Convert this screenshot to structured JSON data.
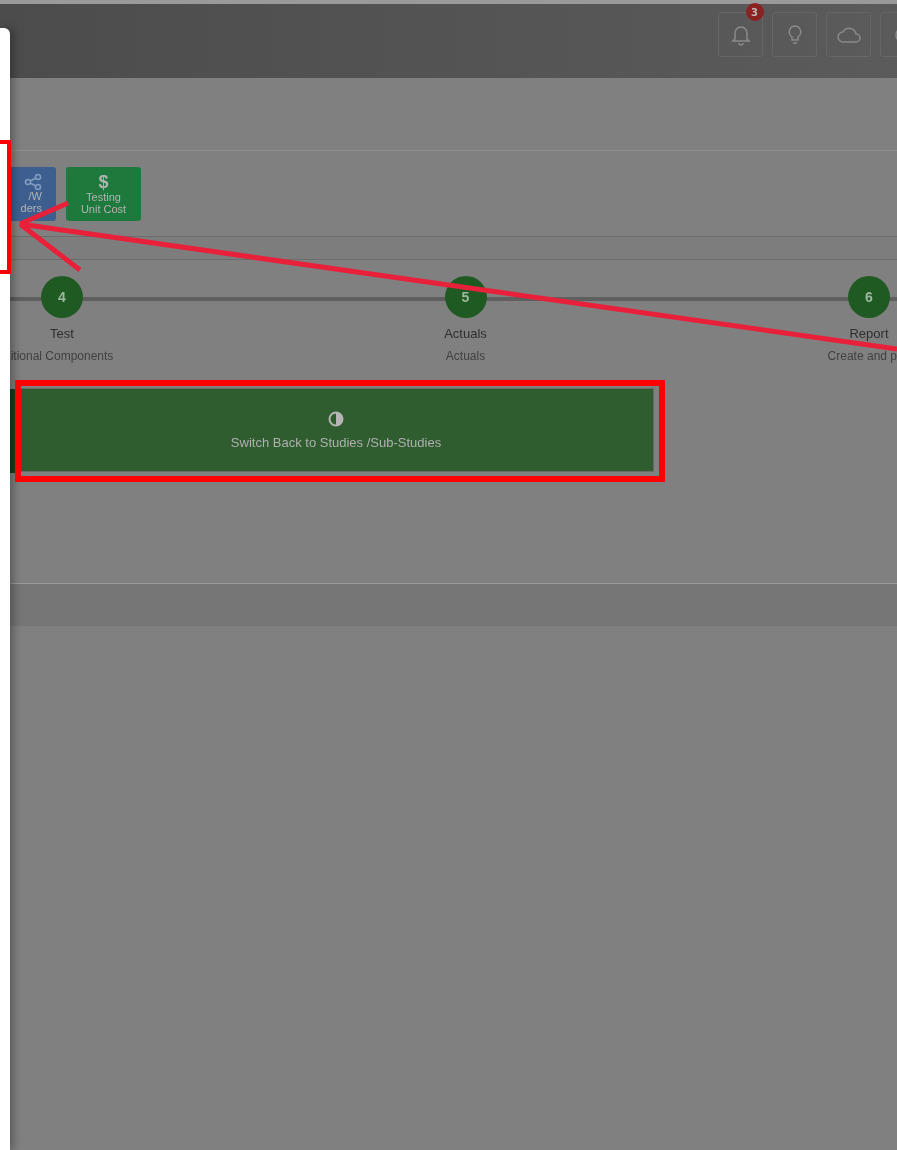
{
  "header": {
    "icons": [
      {
        "kind": "bell",
        "badge": "3"
      },
      {
        "kind": "bulb"
      },
      {
        "kind": "cloud"
      },
      {
        "kind": "partial"
      }
    ]
  },
  "tiles": [
    {
      "kind": "network",
      "color": "#3d5f8f",
      "lines": [
        "/W",
        "ders"
      ]
    },
    {
      "kind": "glyph",
      "glyph": "$",
      "color": "#1e7a3c",
      "lines": [
        "Testing",
        "Unit Cost"
      ]
    }
  ],
  "steps": [
    {
      "number": "4",
      "title": "Test",
      "subtitle": "itional Components"
    },
    {
      "number": "5",
      "title": "Actuals",
      "subtitle": "Actuals"
    },
    {
      "number": "6",
      "title": "Report",
      "subtitle": "Create and p"
    }
  ],
  "switch_button": {
    "label": "Switch Back to Studies /Sub-Studies"
  },
  "annotations": [
    {
      "kind": "left-frame"
    },
    {
      "kind": "button-frame"
    },
    {
      "kind": "arrow"
    }
  ]
}
